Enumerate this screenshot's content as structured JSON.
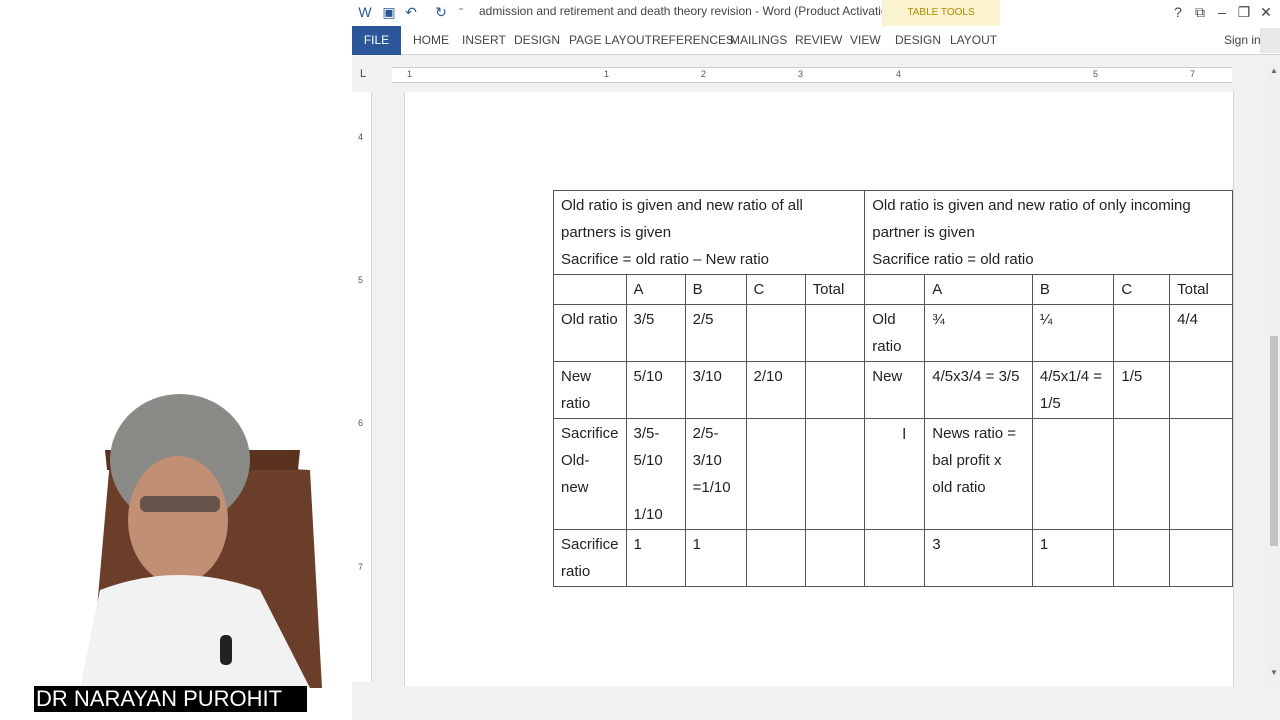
{
  "presenter": {
    "name": "DR NARAYAN PUROHIT"
  },
  "window": {
    "title": "admission and retirement and death theory revision - Word (Product Activation Failed)",
    "context_label": "TABLE TOOLS",
    "controls": {
      "help": "?",
      "restore_ribbon": "⧉",
      "minimize": "–",
      "maximize": "❐",
      "close": "✕"
    }
  },
  "ribbon": {
    "file": "FILE",
    "tabs": [
      "HOME",
      "INSERT",
      "DESIGN",
      "PAGE LAYOUT",
      "REFERENCES",
      "MAILINGS",
      "REVIEW",
      "VIEW"
    ],
    "context_tabs": [
      "DESIGN",
      "LAYOUT"
    ],
    "sign_in": "Sign in"
  },
  "ruler": {
    "tab_selector": "L",
    "marks": [
      "1",
      "1",
      "2",
      "3",
      "4",
      "5",
      "7"
    ],
    "vertical_marks": [
      "4",
      "5",
      "6",
      "7"
    ]
  },
  "table": {
    "header_left": [
      "Old ratio is given and  new ratio of all partners is given",
      "Sacrifice = old ratio – New ratio"
    ],
    "header_right": [
      "Old ratio is given and new ratio of only incoming partner is given",
      "Sacrifice ratio = old ratio"
    ],
    "rows": [
      [
        "",
        "A",
        "B",
        "C",
        "Total",
        "",
        "A",
        "B",
        "C",
        "Total"
      ],
      [
        "Old ratio",
        "3/5",
        "2/5",
        "",
        "",
        "Old ratio",
        "¾",
        "¼",
        "",
        "4/4"
      ],
      [
        "New ratio",
        "5/10",
        "3/10",
        "2/10",
        "",
        "New",
        "4/5x3/4  = 3/5",
        "4/5x1/4 = 1/5",
        "1/5",
        ""
      ],
      [
        "Sacrifice Old- new",
        "3/5-5/10\n\n1/10",
        "2/5-3/10 =1/10",
        "",
        "",
        "",
        "News ratio = bal profit x old ratio",
        "",
        "",
        ""
      ],
      [
        "Sacrifice ratio",
        "1",
        "1",
        "",
        "",
        "",
        "3",
        "1",
        "",
        ""
      ]
    ]
  }
}
